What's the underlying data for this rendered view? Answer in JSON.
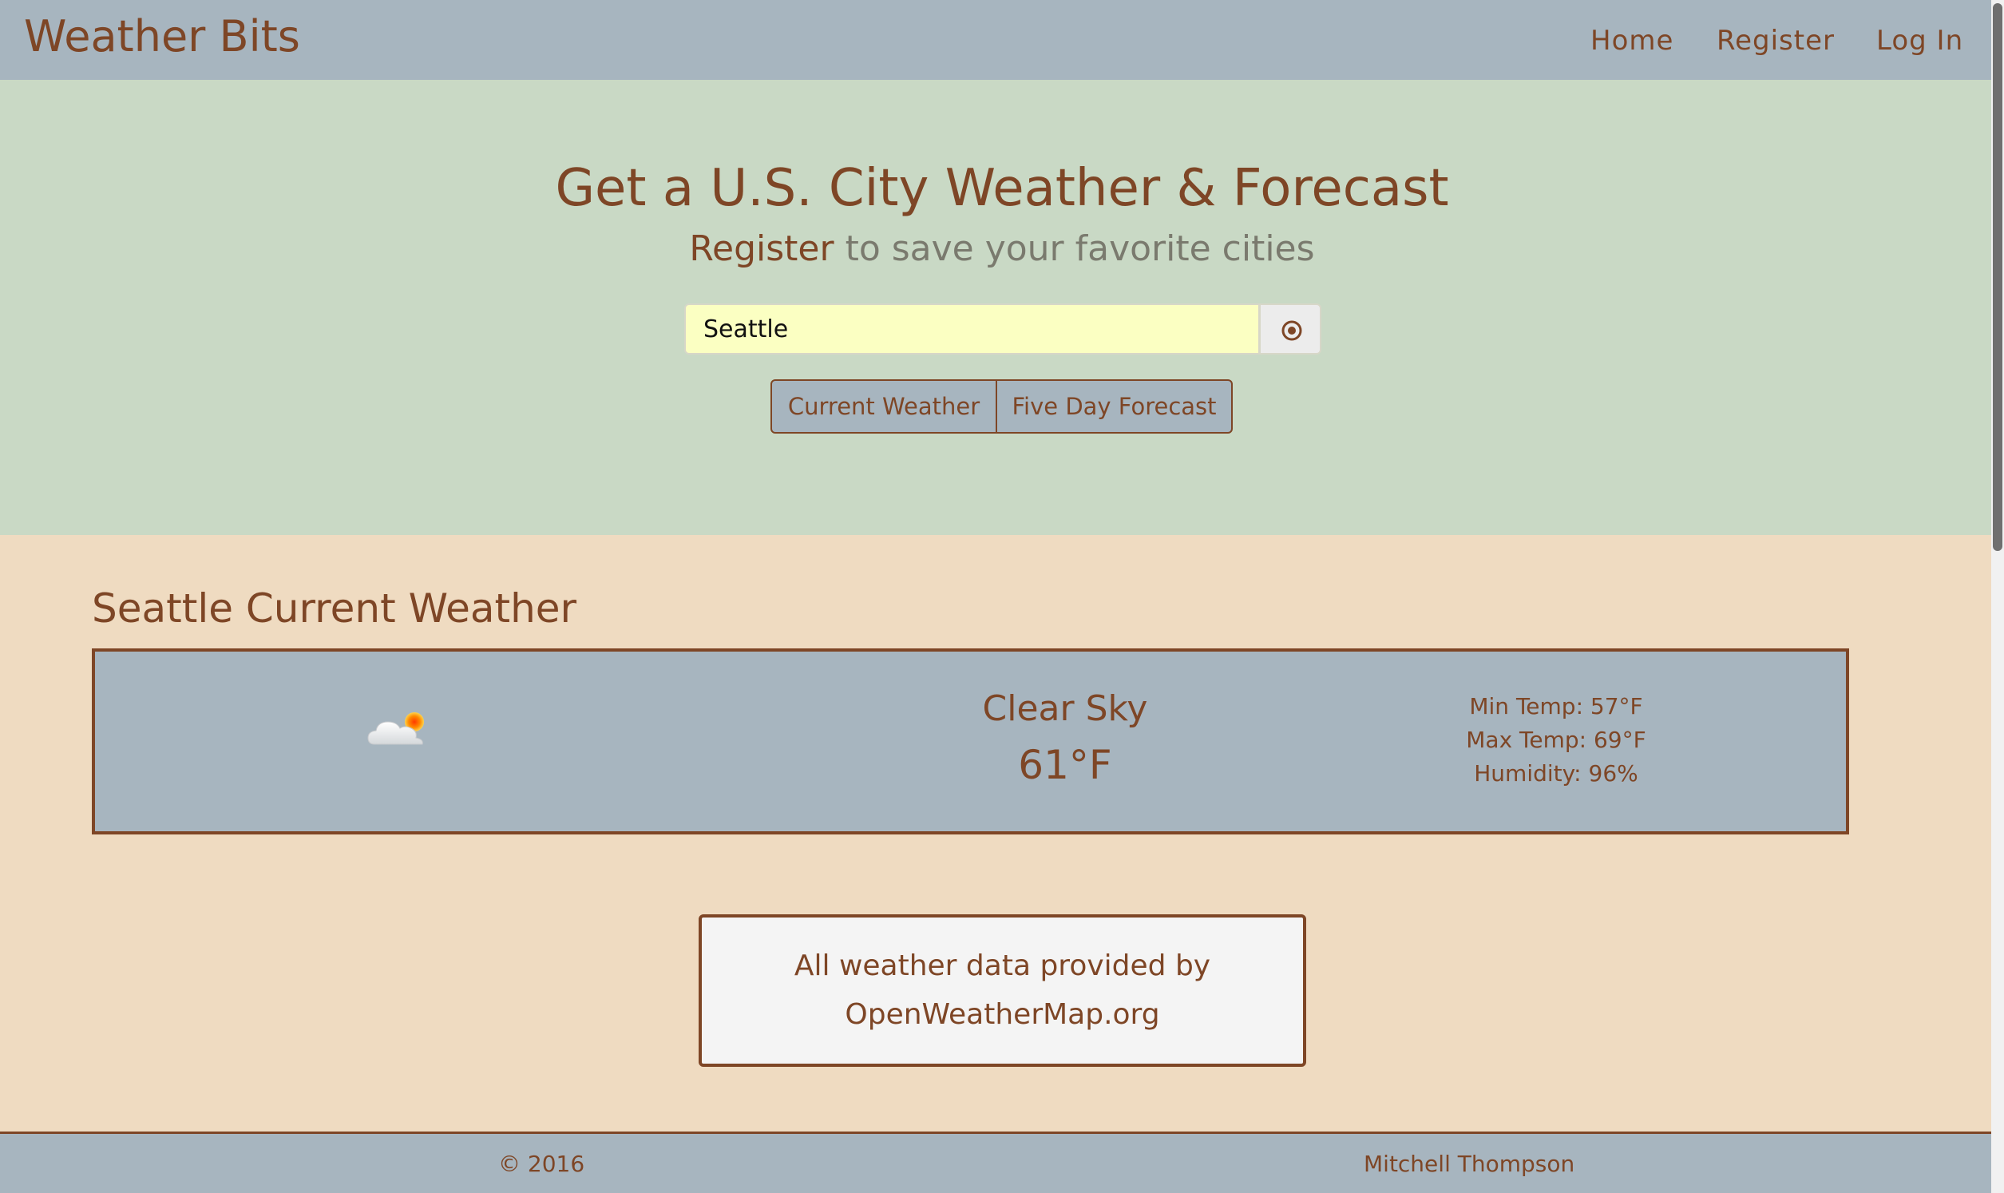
{
  "navbar": {
    "brand": "Weather Bits",
    "links": [
      "Home",
      "Register",
      "Log In"
    ]
  },
  "hero": {
    "title": "Get a U.S. City Weather & Forecast",
    "subtitle_link": "Register",
    "subtitle_rest": " to save your favorite cities",
    "search_value": "Seattle",
    "locate_icon": "locate-target-icon",
    "buttons": [
      "Current Weather",
      "Five Day Forecast"
    ]
  },
  "current": {
    "section_title": "Seattle Current Weather",
    "icon": "cloud-with-sun-icon",
    "description": "Clear Sky",
    "temperature": "61°F",
    "min_temp": "Min Temp: 57°F",
    "max_temp": "Max Temp: 69°F",
    "humidity": "Humidity: 96%"
  },
  "credit": {
    "line1": "All weather data provided by",
    "line2": "OpenWeatherMap.org"
  },
  "footer": {
    "copyright": "© 2016",
    "author": "Mitchell Thompson"
  },
  "colors": {
    "accent_brown": "#7e4626",
    "navbar_gray": "#a7b5bf",
    "hero_green": "#c9d9c5",
    "page_tan": "#efdbc1",
    "input_yellow": "#fbffc2"
  }
}
